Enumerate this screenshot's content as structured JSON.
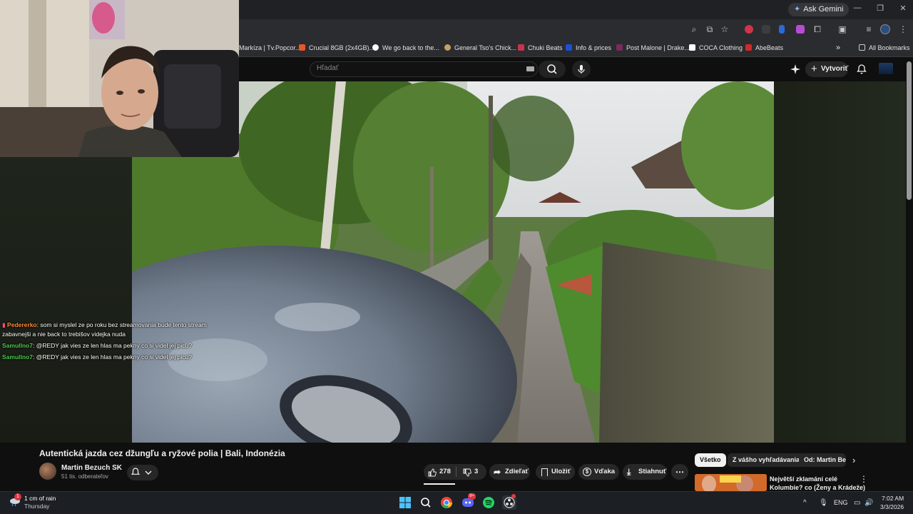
{
  "browser": {
    "gemini_label": "Ask Gemini",
    "bookmarks": [
      {
        "label": "Markíza | Tv.Popcor...",
        "color": "#e0a030"
      },
      {
        "label": "Crucial 8GB (2x4GB)...",
        "color": "#e8562a"
      },
      {
        "label": "We go back to the...",
        "color": "#ffffff"
      },
      {
        "label": "General Tso's Chick...",
        "color": "#c8a060"
      },
      {
        "label": "Chuki Beats",
        "color": "#c9344a"
      },
      {
        "label": "Info & prices",
        "color": "#1d4ed8"
      },
      {
        "label": "Post Malone | Drake...",
        "color": "#7a2b5c"
      },
      {
        "label": "COCA Clothing",
        "color": "#ffffff"
      },
      {
        "label": "AbeBeats",
        "color": "#d02a2a"
      }
    ],
    "all_bookmarks": "All Bookmarks"
  },
  "youtube": {
    "search_placeholder": "Hľadať",
    "create_label": "Vytvoriť"
  },
  "chat": [
    {
      "user": "Pedererko",
      "message": ": som si myslel ze po roku bez streamovania bude tento stream",
      "message2": "zabavnejši a nie back to trebišov videjka nuda",
      "user_color": "#ff8a3a"
    },
    {
      "user": "Samullno7",
      "message": ": @REDY jak vies ze len hlas ma pekny co si videl jej picu?",
      "user_color": "#4ec94e"
    },
    {
      "user": "Samullno7",
      "message": ": @REDY jak vies ze len hlas ma pekny co si videl jej picu?",
      "user_color": "#4ec94e"
    }
  ],
  "video": {
    "title": "Autentická jazda cez džungľu a ryžové polia | Bali, Indonézia",
    "channel": "Martin Bezuch SK",
    "subscribers": "51 tis. odberateľov",
    "likes": "278",
    "dislikes": "3",
    "share_label": "Zdieľať",
    "save_label": "Uložiť",
    "thanks_label": "Vďaka",
    "download_label": "Stiahnuť"
  },
  "recommendations": {
    "chips": [
      "Všetko",
      "Z vášho vyhľadávania",
      "Od: Martin Bez"
    ],
    "first_title_line1": "Největší zklamání celé",
    "first_title_line2": "Kolumbie? co (Ženy a Krádeže)"
  },
  "taskbar": {
    "weather_line1": "1 cm of rain",
    "weather_line2": "Thursday",
    "weather_badge": "1",
    "language": "ENG",
    "time": "7:02 AM",
    "date": "3/3/2026",
    "discord_badge": "9+"
  }
}
